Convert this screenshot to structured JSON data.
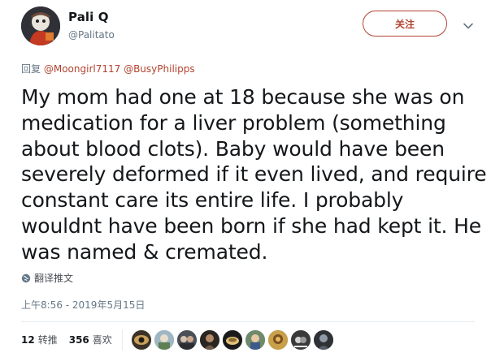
{
  "author": {
    "display_name": "Pali Q",
    "handle": "@Palitato"
  },
  "follow_button": {
    "label": "关注"
  },
  "reply": {
    "prefix": "回复",
    "mentions": [
      "@Moongirl7117",
      "@BusyPhilipps"
    ]
  },
  "tweet": {
    "lines": [
      "My mom had one at 18 because she was on",
      "medication for a liver problem (something",
      "about blood clots). Baby would have been",
      "severely deformed if it even lived, and require",
      "constant care its entire life. I probably",
      "wouldnt have been born if she had kept it. He",
      "was named & cremated."
    ]
  },
  "translate": {
    "label": "翻译推文",
    "icon": "globe-icon"
  },
  "timestamp": "上午8:56 - 2019年5月15日",
  "stats": {
    "retweets": {
      "count": "12",
      "label": "转推"
    },
    "likes": {
      "count": "356",
      "label": "喜欢"
    }
  },
  "likers_count_visible": 9,
  "colors": {
    "accent": "#b2432f",
    "muted": "#657786",
    "text": "#14171a",
    "divider": "#e6ecf0"
  }
}
